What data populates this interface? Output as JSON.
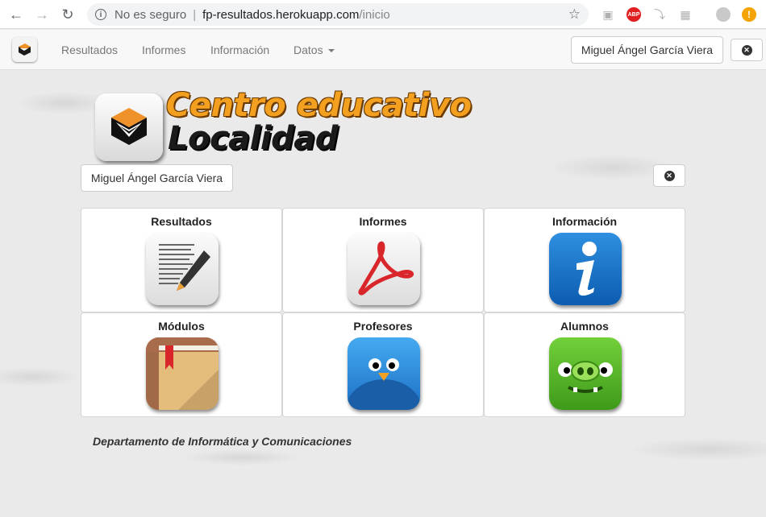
{
  "browser": {
    "security_label": "No es seguro",
    "host": "fp-resultados.herokuapp.com",
    "path": "/inicio",
    "ext_abp": "ABP",
    "ext_warn": "!"
  },
  "navbar": {
    "links": [
      "Resultados",
      "Informes",
      "Información",
      "Datos"
    ],
    "user": "Miguel Ángel García Viera"
  },
  "header": {
    "logo_line1": "Centro educativo",
    "logo_line2": "Localidad",
    "user": "Miguel Ángel García Viera"
  },
  "tiles": [
    {
      "label": "Resultados",
      "icon": "notepad-pencil-icon"
    },
    {
      "label": "Informes",
      "icon": "pdf-icon"
    },
    {
      "label": "Información",
      "icon": "info-icon"
    },
    {
      "label": "Módulos",
      "icon": "book-icon"
    },
    {
      "label": "Profesores",
      "icon": "blue-bird-icon"
    },
    {
      "label": "Alumnos",
      "icon": "green-pig-icon"
    }
  ],
  "footer": "Departamento de Informática y Comunicaciones"
}
